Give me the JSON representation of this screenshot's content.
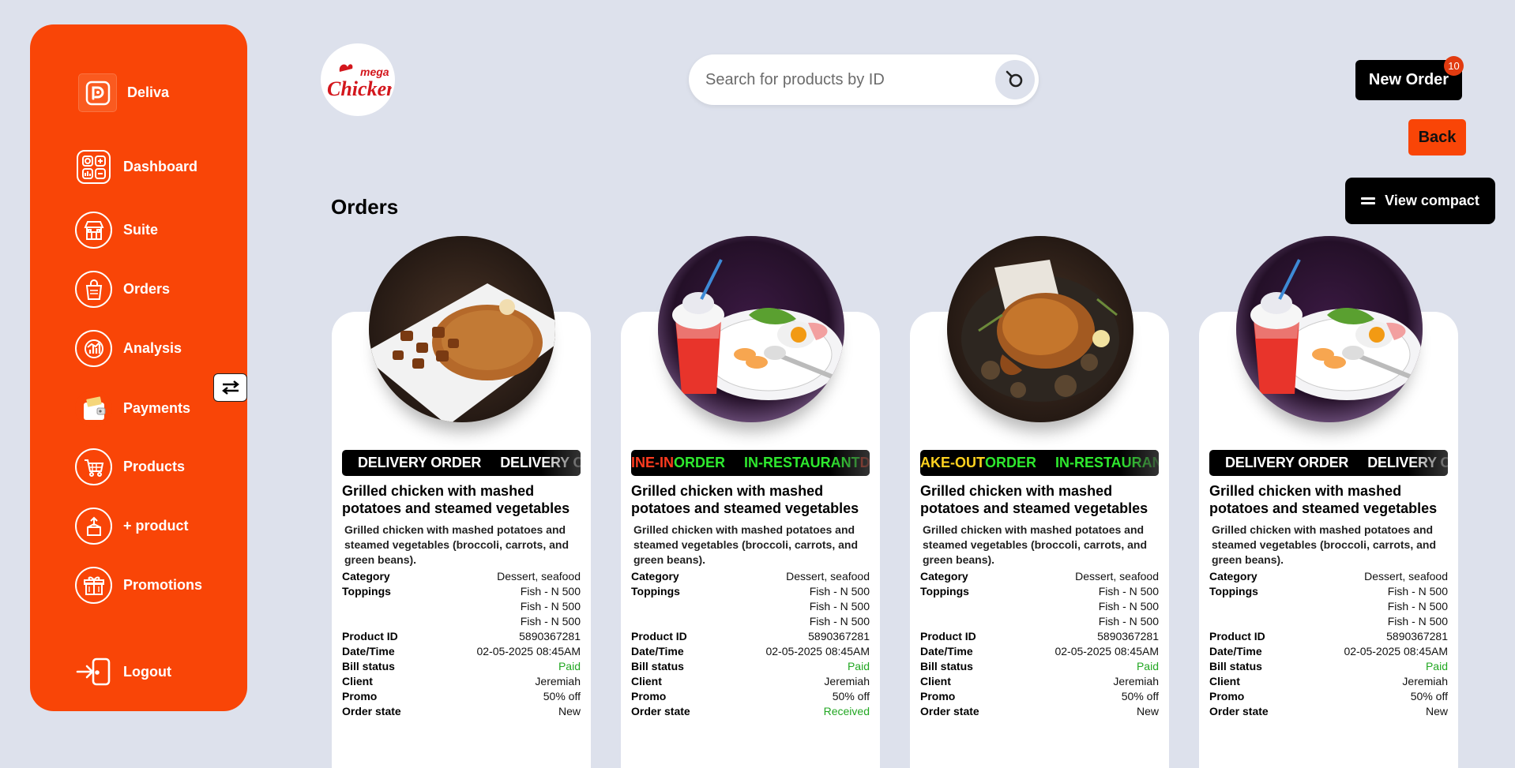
{
  "brand": {
    "name": "Deliva",
    "logo_icon": "deliva-logo-icon"
  },
  "sidebar": {
    "items": [
      {
        "label": "Dashboard",
        "icon": "dashboard-icon"
      },
      {
        "label": "Suite",
        "icon": "store-icon"
      },
      {
        "label": "Orders",
        "icon": "shopping-bag-icon"
      },
      {
        "label": "Analysis",
        "icon": "chart-icon"
      },
      {
        "label": "Payments",
        "icon": "wallet-icon"
      },
      {
        "label": "Products",
        "icon": "cart-icon"
      },
      {
        "label": "+ product",
        "icon": "add-product-icon"
      },
      {
        "label": "Promotions",
        "icon": "gift-icon"
      }
    ],
    "logout_label": "Logout"
  },
  "header": {
    "store_logo_text_top": "mega",
    "store_logo_text_main": "Chicken",
    "search_placeholder": "Search for products by ID",
    "new_order_label": "New Order",
    "new_order_badge": "10",
    "back_label": "Back",
    "compact_label": "View compact"
  },
  "page_title": "Orders",
  "labels": {
    "category": "Category",
    "toppings": "Toppings",
    "product_id": "Product ID",
    "datetime": "Date/Time",
    "bill_status": "Bill status",
    "client": "Client",
    "promo": "Promo",
    "order_state": "Order state"
  },
  "colors": {
    "accent": "#f94507",
    "background": "#dde1ec",
    "status_green": "#22a722"
  },
  "orders": [
    {
      "image": "jollof-rice-plantain",
      "ticker": [
        {
          "text": "DELIVERY ORDER",
          "color": "#ffffff"
        },
        {
          "text": "DELIVERY ORDER",
          "color": "#ffffff"
        }
      ],
      "title": "Grilled chicken with mashed potatoes and steamed vegetables",
      "description": "Grilled chicken with mashed potatoes and steamed vegetables (broccoli, carrots, and green beans).",
      "category": "Dessert, seafood",
      "toppings": [
        "Fish - N 500",
        "Fish - N 500",
        "Fish - N 500"
      ],
      "product_id": "5890367281",
      "datetime": "02-05-2025 08:45AM",
      "bill_status": "Paid",
      "client": "Jeremiah",
      "promo": "50% off",
      "order_state": "New"
    },
    {
      "image": "breakfast-plate-with-drink",
      "ticker": [
        {
          "text": "INE-IN",
          "color": "#ff3b1f"
        },
        {
          "text": " ORDER",
          "color": "#2ee82e"
        },
        {
          "text": "IN-RESTAURANT",
          "color": "#2ee82e"
        },
        {
          "text": " DI",
          "color": "#ff3b1f"
        }
      ],
      "title": "Grilled chicken with mashed potatoes and steamed vegetables",
      "description": "Grilled chicken with mashed potatoes and steamed vegetables (broccoli, carrots, and green beans).",
      "category": "Dessert, seafood",
      "toppings": [
        "Fish - N 500",
        "Fish - N 500",
        "Fish - N 500"
      ],
      "product_id": "5890367281",
      "datetime": "02-05-2025 08:45AM",
      "bill_status": "Paid",
      "client": "Jeremiah",
      "promo": "50% off",
      "order_state": "Received"
    },
    {
      "image": "roast-chicken",
      "ticker": [
        {
          "text": "AKE-OUT",
          "color": "#ffd21f"
        },
        {
          "text": " ORDER",
          "color": "#2ee82e"
        },
        {
          "text": "IN-RESTAURANT",
          "color": "#2ee82e"
        },
        {
          "text": " T",
          "color": "#ffd21f"
        }
      ],
      "title": "Grilled chicken with mashed potatoes and steamed vegetables",
      "description": "Grilled chicken with mashed potatoes and steamed vegetables (broccoli, carrots, and green beans).",
      "category": "Dessert, seafood",
      "toppings": [
        "Fish - N 500",
        "Fish - N 500",
        "Fish - N 500"
      ],
      "product_id": "5890367281",
      "datetime": "02-05-2025 08:45AM",
      "bill_status": "Paid",
      "client": "Jeremiah",
      "promo": "50% off",
      "order_state": "New"
    },
    {
      "image": "breakfast-plate-with-drink",
      "ticker": [
        {
          "text": "DELIVERY ORDER",
          "color": "#ffffff"
        },
        {
          "text": "DELIVERY ORDER",
          "color": "#ffffff"
        }
      ],
      "title": "Grilled chicken with mashed potatoes and steamed vegetables",
      "description": "Grilled chicken with mashed potatoes and steamed vegetables (broccoli, carrots, and green beans).",
      "category": "Dessert, seafood",
      "toppings": [
        "Fish - N 500",
        "Fish - N 500",
        "Fish - N 500"
      ],
      "product_id": "5890367281",
      "datetime": "02-05-2025 08:45AM",
      "bill_status": "Paid",
      "client": "Jeremiah",
      "promo": "50% off",
      "order_state": "New"
    }
  ]
}
